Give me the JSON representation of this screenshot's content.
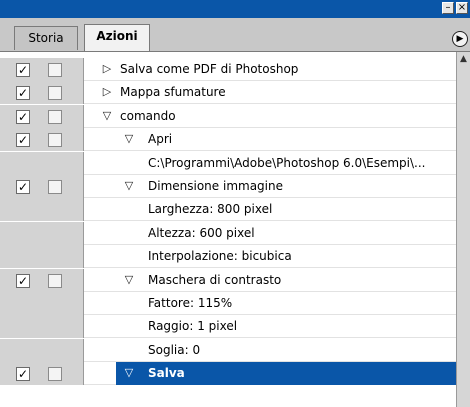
{
  "window": {
    "minimize_glyph": "–",
    "close_glyph": "×"
  },
  "tabs": [
    {
      "label": "Storia",
      "active": false
    },
    {
      "label": "Azioni",
      "active": true
    }
  ],
  "colors": {
    "selection": "#0a56a8",
    "titlebar": "#0a56a8"
  },
  "rows": [
    {
      "checked": true,
      "level": 1,
      "tri": "right",
      "label": "Salva come PDF di Photoshop"
    },
    {
      "checked": true,
      "level": 1,
      "tri": "right",
      "label": "Mappa sfumature"
    },
    {
      "checked": true,
      "level": 1,
      "tri": "down",
      "label": "comando"
    },
    {
      "checked": true,
      "level": 2,
      "tri": "down",
      "label": "Apri"
    },
    {
      "checked": null,
      "level": 3,
      "tri": "",
      "label": "C:\\Programmi\\Adobe\\Photoshop 6.0\\Esempi\\..."
    },
    {
      "checked": true,
      "level": 2,
      "tri": "down",
      "label": "Dimensione immagine"
    },
    {
      "checked": null,
      "level": 3,
      "tri": "",
      "label": "Larghezza: 800 pixel"
    },
    {
      "checked": null,
      "level": 3,
      "tri": "",
      "label": "Altezza: 600 pixel"
    },
    {
      "checked": null,
      "level": 3,
      "tri": "",
      "label": "Interpolazione: bicubica"
    },
    {
      "checked": true,
      "level": 2,
      "tri": "down",
      "label": "Maschera di contrasto"
    },
    {
      "checked": null,
      "level": 3,
      "tri": "",
      "label": "Fattore: 115%"
    },
    {
      "checked": null,
      "level": 3,
      "tri": "",
      "label": "Raggio: 1 pixel"
    },
    {
      "checked": null,
      "level": 3,
      "tri": "",
      "label": "Soglia: 0"
    },
    {
      "checked": true,
      "level": 2,
      "tri": "down",
      "label": "Salva",
      "selected": true
    }
  ],
  "icons": {
    "checkmark": "✓",
    "tri_right": "▷",
    "tri_down": "▽",
    "scroll_up": "▲",
    "panel_menu": "▶"
  }
}
